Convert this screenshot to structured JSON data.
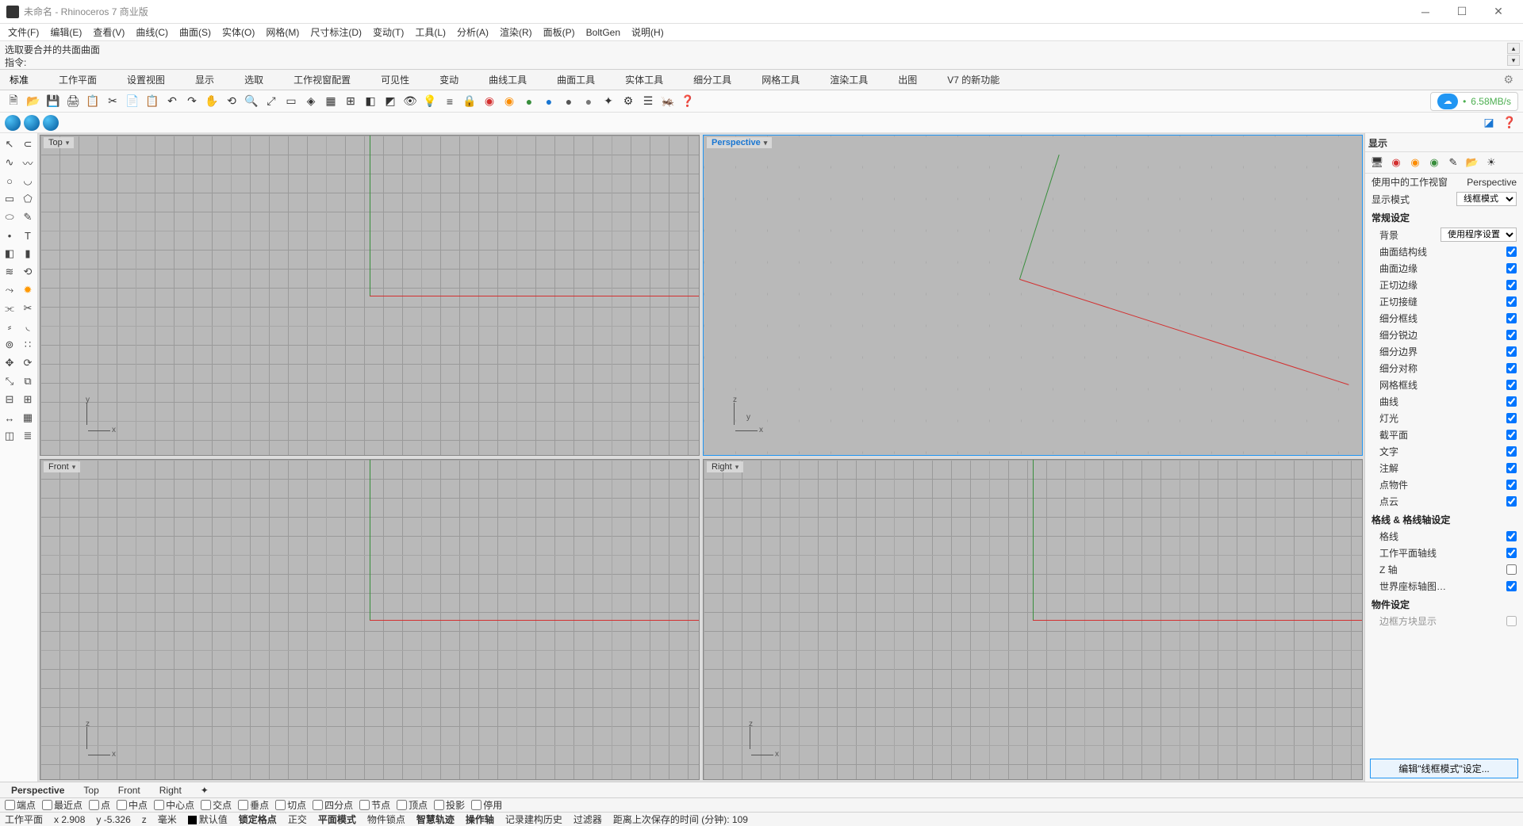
{
  "title": "未命名 - Rhinoceros 7 商业版",
  "menubar": [
    "文件(F)",
    "编辑(E)",
    "查看(V)",
    "曲线(C)",
    "曲面(S)",
    "实体(O)",
    "网格(M)",
    "尺寸标注(D)",
    "变动(T)",
    "工具(L)",
    "分析(A)",
    "渲染(R)",
    "面板(P)",
    "BoltGen",
    "说明(H)"
  ],
  "cmd_history": "选取要合并的共面曲面",
  "cmd_prompt_label": "指令:",
  "tabs": [
    "标准",
    "工作平面",
    "设置视图",
    "显示",
    "选取",
    "工作视窗配置",
    "可见性",
    "变动",
    "曲线工具",
    "曲面工具",
    "实体工具",
    "细分工具",
    "网格工具",
    "渲染工具",
    "出图",
    "V7 的新功能"
  ],
  "cloud_speed": "6.58MB/s",
  "viewports": {
    "top": "Top",
    "perspective": "Perspective",
    "front": "Front",
    "right": "Right"
  },
  "vp_tabs": [
    "Perspective",
    "Top",
    "Front",
    "Right"
  ],
  "osnaps": [
    {
      "label": "端点",
      "checked": false
    },
    {
      "label": "最近点",
      "checked": false
    },
    {
      "label": "点",
      "checked": false
    },
    {
      "label": "中点",
      "checked": false
    },
    {
      "label": "中心点",
      "checked": false
    },
    {
      "label": "交点",
      "checked": false
    },
    {
      "label": "垂点",
      "checked": false
    },
    {
      "label": "切点",
      "checked": false
    },
    {
      "label": "四分点",
      "checked": false
    },
    {
      "label": "节点",
      "checked": false
    },
    {
      "label": "顶点",
      "checked": false
    },
    {
      "label": "投影",
      "checked": false
    },
    {
      "label": "停用",
      "checked": false
    }
  ],
  "status": {
    "cplane": "工作平面",
    "x_label": "x",
    "x": "2.908",
    "y_label": "y",
    "y": "-5.326",
    "z_label": "z",
    "z": "",
    "units": "毫米",
    "layer": "默认值",
    "gridsnap": "锁定格点",
    "ortho": "正交",
    "planar": "平面模式",
    "osnap": "物件锁点",
    "smarttrack": "智慧轨迹",
    "gumball": "操作轴",
    "history": "记录建构历史",
    "filter": "过滤器",
    "timer": "距离上次保存的时间 (分钟): 109"
  },
  "panel": {
    "title": "显示",
    "active_viewport_label": "使用中的工作视窗",
    "active_viewport_value": "Perspective",
    "display_mode_label": "显示模式",
    "display_mode_value": "线框模式",
    "section_general": "常规设定",
    "background_label": "背景",
    "background_value": "使用程序设置",
    "checks": [
      {
        "label": "曲面结构线",
        "on": true
      },
      {
        "label": "曲面边缘",
        "on": true
      },
      {
        "label": "正切边缘",
        "on": true
      },
      {
        "label": "正切接缝",
        "on": true
      },
      {
        "label": "细分框线",
        "on": true
      },
      {
        "label": "细分锐边",
        "on": true
      },
      {
        "label": "细分边界",
        "on": true
      },
      {
        "label": "细分对称",
        "on": true
      },
      {
        "label": "网格框线",
        "on": true
      },
      {
        "label": "曲线",
        "on": true
      },
      {
        "label": "灯光",
        "on": true
      },
      {
        "label": "截平面",
        "on": true
      },
      {
        "label": "文字",
        "on": true
      },
      {
        "label": "注解",
        "on": true
      },
      {
        "label": "点物件",
        "on": true
      },
      {
        "label": "点云",
        "on": true
      }
    ],
    "section_grid": "格线 & 格线轴设定",
    "grid_checks": [
      {
        "label": "格线",
        "on": true
      },
      {
        "label": "工作平面轴线",
        "on": true
      },
      {
        "label": "Z 轴",
        "on": false
      },
      {
        "label": "世界座标轴图…",
        "on": true
      }
    ],
    "section_obj": "物件设定",
    "obj_row": "边框方块显示",
    "edit_button": "编辑\"线框模式\"设定..."
  }
}
